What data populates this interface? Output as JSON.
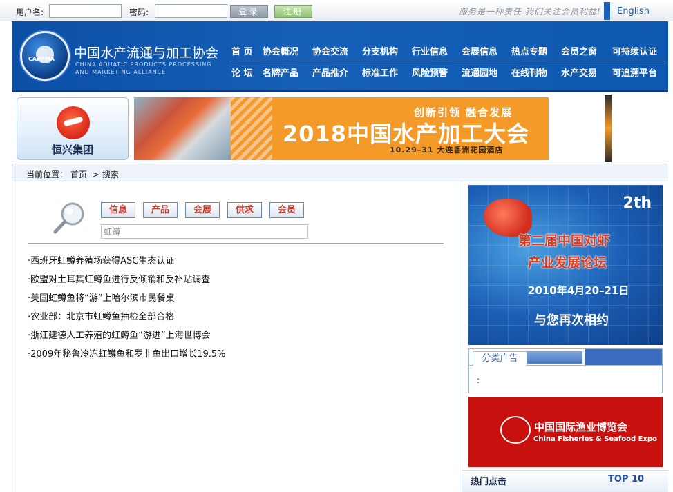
{
  "topbar": {
    "username_label": "用户名:",
    "username_value": "",
    "password_label": "密码:",
    "password_value": "",
    "login_label": "登录",
    "register_label": "注册",
    "slogan": "服务是一种责任 我们关注会员利益!",
    "english_label": "English"
  },
  "header": {
    "logo_caption": "CAPPMA",
    "org_name": "中国水产流通与加工协会",
    "org_name_en_line1": "CHINA AQUATIC PRODUCTS PROCESSING",
    "org_name_en_line2": "AND MARKETING ALLIANCE",
    "nav_row1": [
      "首 页",
      "协会概况",
      "协会交流",
      "分支机构",
      "行业信息",
      "会展信息",
      "热点专题",
      "会员之窗",
      "可持续认证"
    ],
    "nav_row2": [
      "论 坛",
      "名牌产品",
      "产品推介",
      "标准工作",
      "风险预警",
      "流通园地",
      "在线刊物",
      "水产交易",
      "可追溯平台"
    ]
  },
  "banner": {
    "left_company": "恒兴集团",
    "subtitle": "创新引领 融合发展",
    "title": "2018中国水产加工大会",
    "date_venue": "10.29–31 大连香洲花园酒店"
  },
  "breadcrumb": {
    "prefix": "当前位置：",
    "home": "首页",
    "separator": ">",
    "current": "搜索"
  },
  "search": {
    "categories": [
      "信息",
      "产品",
      "会展",
      "供求",
      "会员"
    ],
    "keyword": "虹鳟",
    "results": [
      "·西班牙虹鳟养殖场获得ASC生态认证",
      "·欧盟对土耳其虹鳟鱼进行反倾销和反补贴调查",
      "·美国虹鳟鱼将“游”上哈尔滨市民餐桌",
      "·农业部：北京市虹鳟鱼抽检全部合格",
      "·浙江建德人工养殖的虹鳟鱼“游进”上海世博会",
      "·2009年秘鲁冷冻虹鳟鱼和罗非鱼出口增长19.5%"
    ]
  },
  "sidebar": {
    "ad1": {
      "ordinal": "2th",
      "title_line1": "第二届中国对虾",
      "title_line2": "产业发展论坛",
      "date": "2010年4月20–21日",
      "tagline": "与您再次相约"
    },
    "classified_tab": "分类广告",
    "classified_content": ":",
    "ad2": {
      "title_cn": "中国国际渔业博览会",
      "title_en": "China Fisheries & Seafood Expo"
    },
    "hot_label": "热门点击",
    "top_label": "TOP 10"
  },
  "colors": {
    "header_blue": "#1660b8",
    "banner_orange": "#f39a29",
    "category_text_red": "#c0392b",
    "expo_red": "#c8100e"
  }
}
